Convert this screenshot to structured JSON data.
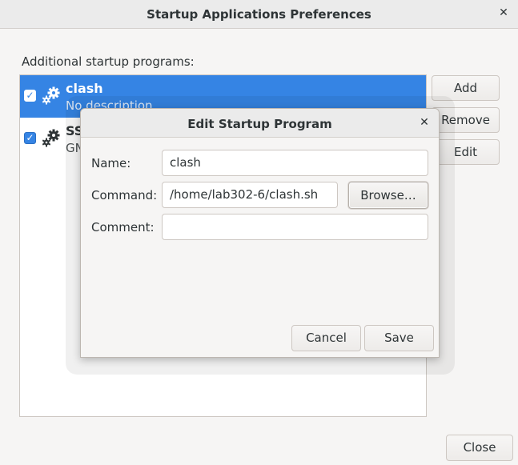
{
  "window": {
    "title": "Startup Applications Preferences",
    "close_glyph": "✕"
  },
  "main": {
    "section_label": "Additional startup programs:",
    "programs": [
      {
        "name": "clash",
        "description": "No description",
        "enabled": true,
        "selected": true,
        "icon": "gear-icon"
      },
      {
        "name": "SS",
        "description": "GN",
        "enabled": true,
        "selected": false,
        "icon": "gear-icon"
      }
    ],
    "buttons": {
      "add": "Add",
      "remove": "Remove",
      "edit": "Edit"
    },
    "close_button": "Close"
  },
  "dialog": {
    "title": "Edit Startup Program",
    "close_glyph": "✕",
    "name_label": "Name:",
    "name_value": "clash",
    "command_label": "Command:",
    "command_value": "/home/lab302-6/clash.sh",
    "browse_label": "Browse…",
    "comment_label": "Comment:",
    "comment_value": "",
    "cancel_label": "Cancel",
    "save_label": "Save"
  },
  "colors": {
    "accent": "#3584e4",
    "window_bg": "#f6f5f4"
  },
  "check_glyph": "✓"
}
